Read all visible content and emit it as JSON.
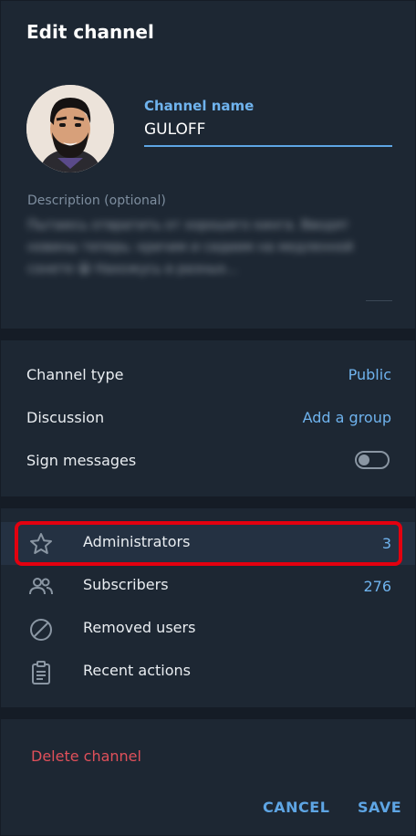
{
  "dialog": {
    "title": "Edit channel"
  },
  "channel": {
    "name_label": "Channel name",
    "name_value": "GULOFF",
    "description_label": "Description (optional)",
    "description_text": "Пытаюсь отвратить от хорошего кинга. Вводят новины теперь: кричим и сидиим на медленной сонете 😀 Нахожусь в разных..."
  },
  "settings": {
    "channel_type_label": "Channel type",
    "channel_type_value": "Public",
    "discussion_label": "Discussion",
    "discussion_value": "Add a group",
    "sign_messages_label": "Sign messages",
    "sign_messages_on": false
  },
  "management": {
    "items": [
      {
        "label": "Administrators",
        "count": "3",
        "icon": "star-icon"
      },
      {
        "label": "Subscribers",
        "count": "276",
        "icon": "users-icon"
      },
      {
        "label": "Removed users",
        "count": "",
        "icon": "block-icon"
      },
      {
        "label": "Recent actions",
        "count": "",
        "icon": "clipboard-icon"
      }
    ]
  },
  "actions": {
    "delete_label": "Delete channel",
    "cancel_label": "CANCEL",
    "save_label": "SAVE"
  },
  "colors": {
    "accent": "#6fb3ee",
    "danger": "#e0505a",
    "highlight_box": "#e3000f",
    "background": "#1d2733"
  }
}
